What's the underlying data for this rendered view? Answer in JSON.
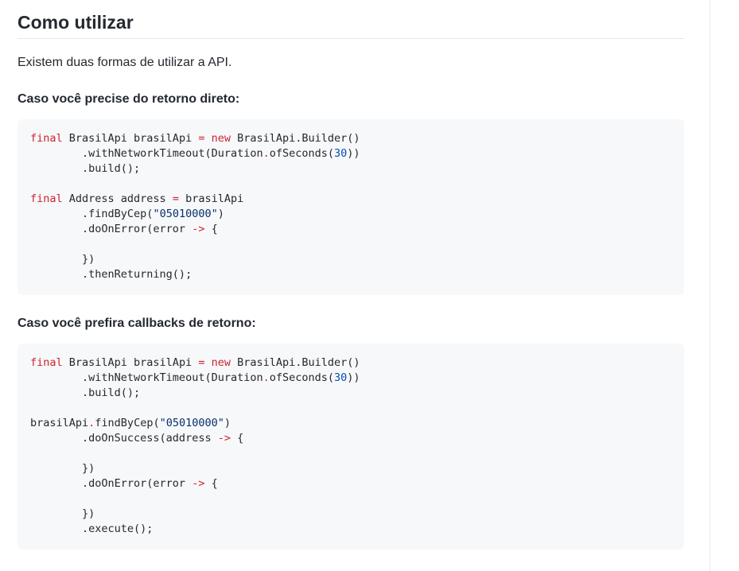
{
  "heading": "Como utilizar",
  "intro": "Existem duas formas de utilizar a API.",
  "section1": {
    "title": "Caso você precise do retorno direto:",
    "code": [
      [
        [
          "k",
          "final"
        ],
        [
          "p",
          " BrasilApi brasilApi "
        ],
        [
          "k",
          "="
        ],
        [
          "p",
          " "
        ],
        [
          "k",
          "new"
        ],
        [
          "p",
          " BrasilApi.Builder()"
        ]
      ],
      [
        [
          "p",
          "        .withNetworkTimeout(Duration"
        ],
        [
          "k",
          "."
        ],
        [
          "p",
          "ofSeconds("
        ],
        [
          "n",
          "30"
        ],
        [
          "p",
          "))"
        ]
      ],
      [
        [
          "p",
          "        .build();"
        ]
      ],
      [
        [
          "p",
          ""
        ]
      ],
      [
        [
          "k",
          "final"
        ],
        [
          "p",
          " Address address "
        ],
        [
          "k",
          "="
        ],
        [
          "p",
          " brasilApi"
        ]
      ],
      [
        [
          "p",
          "        .findByCep("
        ],
        [
          "s",
          "\"05010000\""
        ],
        [
          "p",
          ")"
        ]
      ],
      [
        [
          "p",
          "        .doOnError(error "
        ],
        [
          "k",
          "->"
        ],
        [
          "p",
          " {"
        ]
      ],
      [
        [
          "p",
          ""
        ]
      ],
      [
        [
          "p",
          "        })"
        ]
      ],
      [
        [
          "p",
          "        .thenReturning();"
        ]
      ]
    ]
  },
  "section2": {
    "title": "Caso você prefira callbacks de retorno:",
    "code": [
      [
        [
          "k",
          "final"
        ],
        [
          "p",
          " BrasilApi brasilApi "
        ],
        [
          "k",
          "="
        ],
        [
          "p",
          " "
        ],
        [
          "k",
          "new"
        ],
        [
          "p",
          " BrasilApi.Builder()"
        ]
      ],
      [
        [
          "p",
          "        .withNetworkTimeout(Duration"
        ],
        [
          "k",
          "."
        ],
        [
          "p",
          "ofSeconds("
        ],
        [
          "n",
          "30"
        ],
        [
          "p",
          "))"
        ]
      ],
      [
        [
          "p",
          "        .build();"
        ]
      ],
      [
        [
          "p",
          ""
        ]
      ],
      [
        [
          "p",
          "brasilApi"
        ],
        [
          "k",
          "."
        ],
        [
          "p",
          "findByCep("
        ],
        [
          "s",
          "\"05010000\""
        ],
        [
          "p",
          ")"
        ]
      ],
      [
        [
          "p",
          "        .doOnSuccess(address "
        ],
        [
          "k",
          "->"
        ],
        [
          "p",
          " {"
        ]
      ],
      [
        [
          "p",
          ""
        ]
      ],
      [
        [
          "p",
          "        })"
        ]
      ],
      [
        [
          "p",
          "        .doOnError(error "
        ],
        [
          "k",
          "->"
        ],
        [
          "p",
          " {"
        ]
      ],
      [
        [
          "p",
          ""
        ]
      ],
      [
        [
          "p",
          "        })"
        ]
      ],
      [
        [
          "p",
          "        .execute();"
        ]
      ]
    ]
  }
}
